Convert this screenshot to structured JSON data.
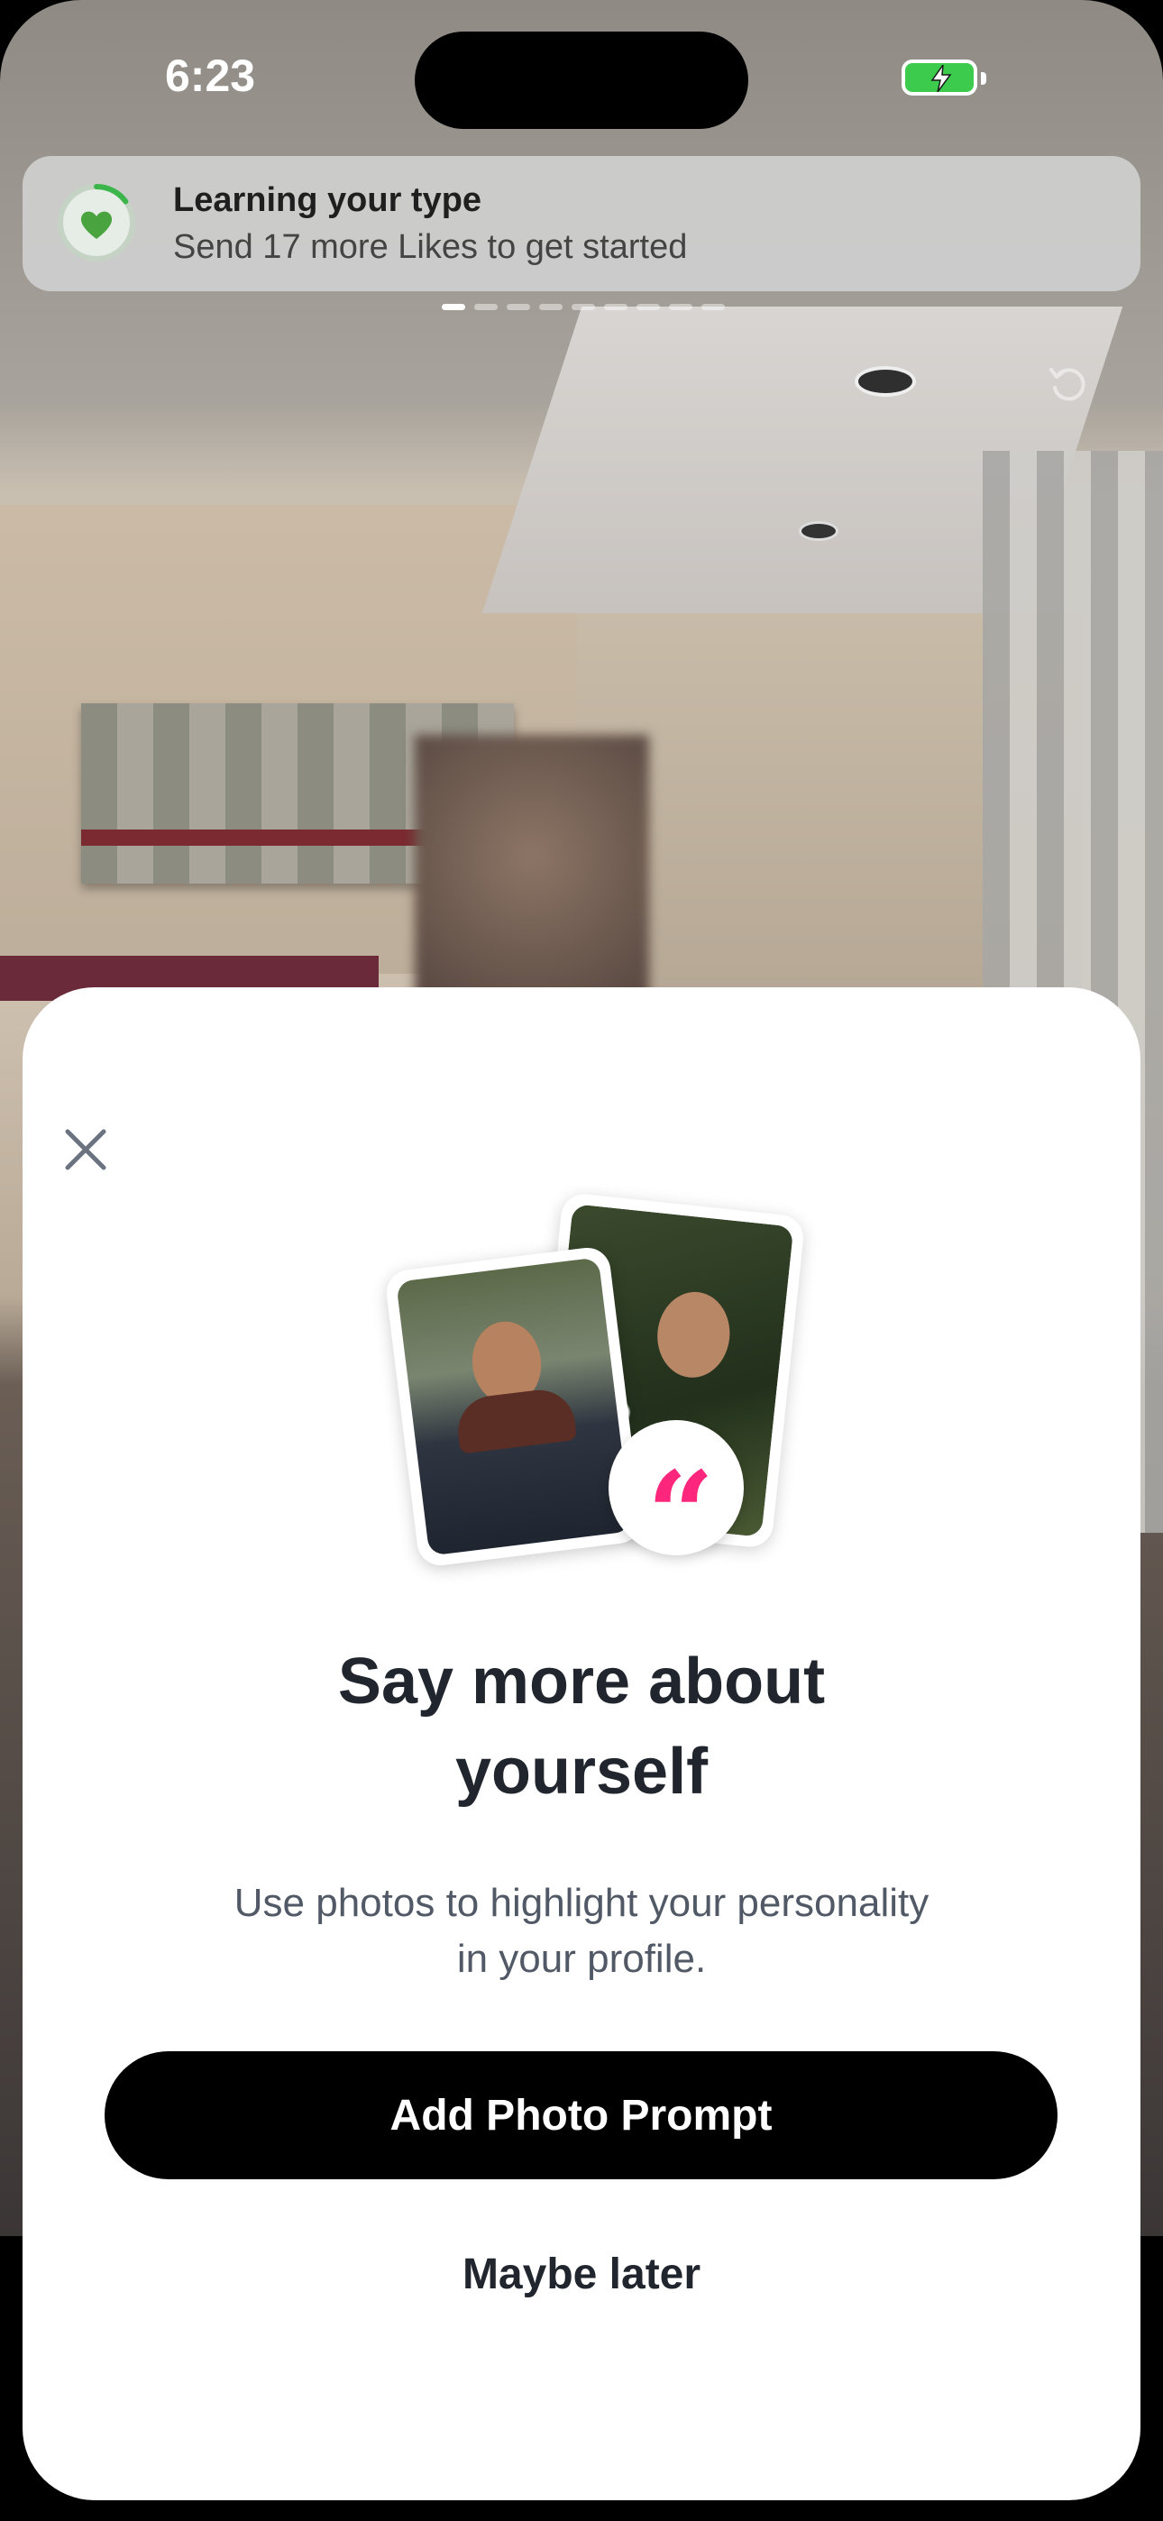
{
  "status_bar": {
    "time": "6:23"
  },
  "banner": {
    "title": "Learning your type",
    "subtitle": "Send 17 more Likes to get started",
    "progress_fraction": 0.15,
    "accent_color": "#3cb54a"
  },
  "photo_pager": {
    "count": 9,
    "active_index": 0
  },
  "modal": {
    "title_line1": "Say more about",
    "title_line2": "yourself",
    "description_line1": "Use photos to highlight your personality",
    "description_line2": "in your profile.",
    "primary_button": "Add Photo Prompt",
    "secondary_button": "Maybe later",
    "quote_glyph": "“",
    "accent_color": "#fd267d"
  },
  "icons": {
    "close": "close-icon",
    "undo": "undo-icon",
    "heart": "heart-icon",
    "battery": "battery-charging-icon"
  }
}
